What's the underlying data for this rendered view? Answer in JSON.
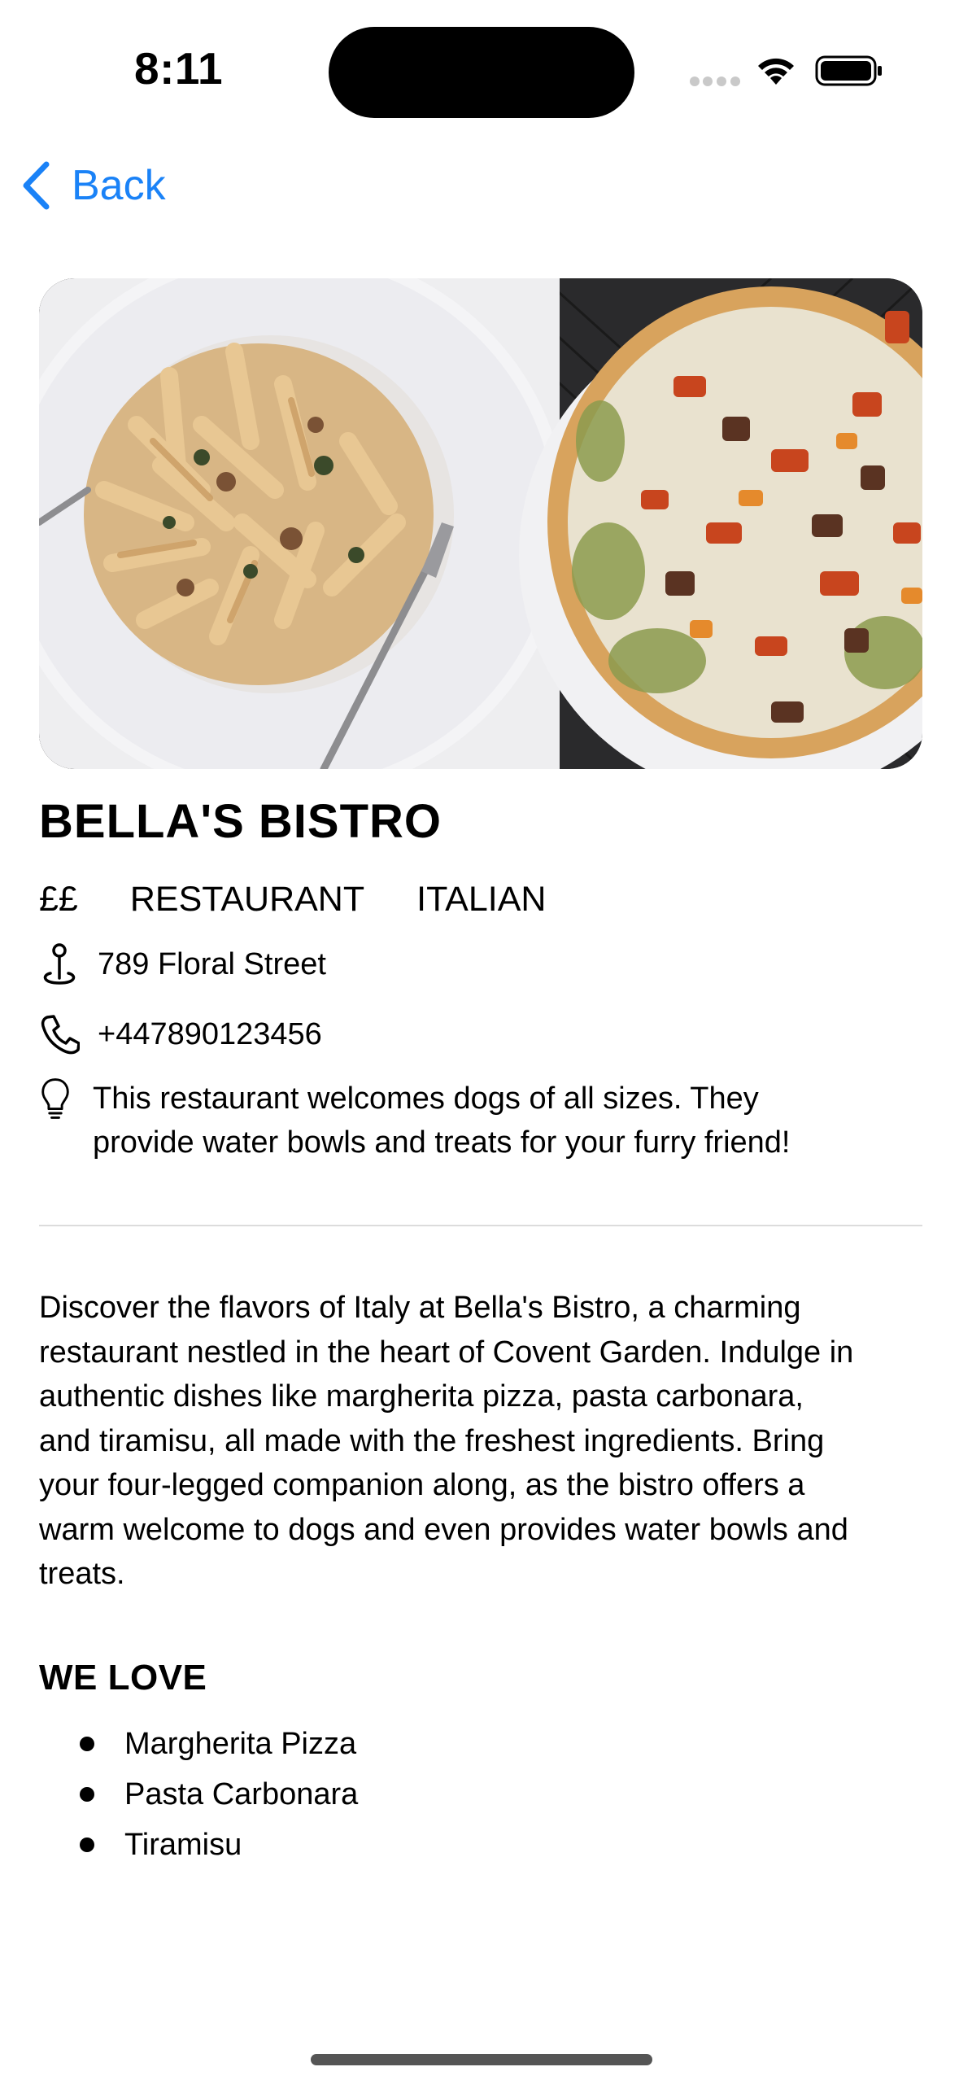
{
  "status_bar": {
    "time": "8:11"
  },
  "nav": {
    "back_label": "Back",
    "accent_color": "#1a82f7"
  },
  "hero": {
    "image_description_icon": "food-photo"
  },
  "restaurant": {
    "name": "BELLA'S BISTRO",
    "price": "££",
    "type": "RESTAURANT",
    "cuisine": "ITALIAN",
    "address": "789 Floral Street",
    "phone": "+447890123456",
    "tip_line_1": "This restaurant welcomes dogs of all sizes. They",
    "tip_line_2": "provide water bowls and treats for your furry friend!",
    "description_lines": [
      "Discover the flavors of Italy at Bella's Bistro, a charming",
      "restaurant nestled in the heart of Covent Garden. Indulge in",
      "authentic dishes like margherita pizza, pasta carbonara,",
      "and tiramisu, all made with the freshest ingredients. Bring",
      "your four-legged companion along, as the bistro offers a",
      "warm welcome to dogs and even provides water bowls and",
      "treats."
    ]
  },
  "we_love": {
    "heading": "WE LOVE",
    "items": [
      "Margherita Pizza",
      "Pasta Carbonara",
      "Tiramisu"
    ]
  }
}
